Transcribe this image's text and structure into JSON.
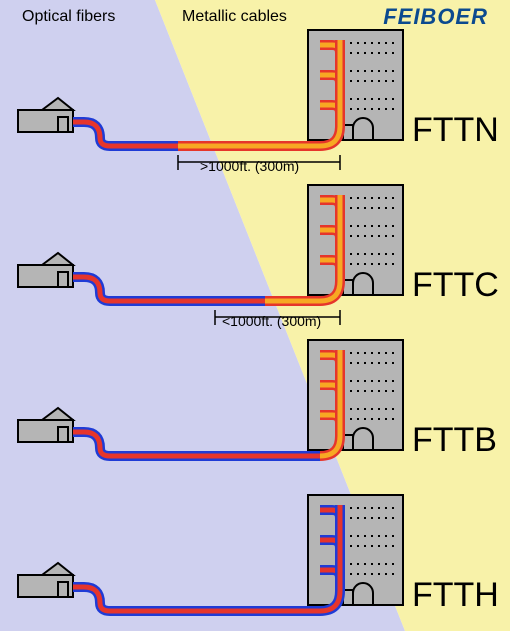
{
  "header": {
    "optical_label": "Optical fibers",
    "metallic_label": "Metallic cables",
    "brand": "FEIBOER"
  },
  "rows": [
    {
      "label": "FTTN",
      "distance": ">1000ft. (300m)"
    },
    {
      "label": "FTTC",
      "distance": "<1000ft. (300m)"
    },
    {
      "label": "FTTB",
      "distance": ""
    },
    {
      "label": "FTTH",
      "distance": ""
    }
  ],
  "colors": {
    "optical_bg": "#cfd0ef",
    "metallic_bg": "#f8f2a9",
    "fiber_outer": "#1f3bd6",
    "fiber_inner": "#e6352b",
    "metal_outer": "#e6352b",
    "metal_inner": "#f7a823",
    "house_fill": "#b5b5b5",
    "house_stroke": "#000",
    "building_fill": "#b5b5b5"
  }
}
